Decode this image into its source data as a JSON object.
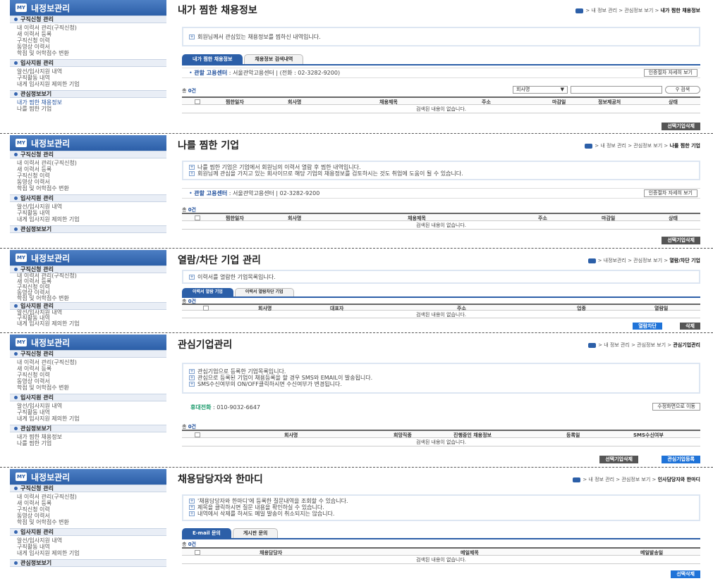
{
  "sidebar": {
    "title": "내정보관리",
    "icon_text": "MY",
    "sec_job": "구직신청 관리",
    "job_items": [
      "내 이력서 관리(구직신청)",
      "새 이력서 등록",
      "구직신청 이력",
      "동영상 이력서",
      "학점 및 어학점수 변환"
    ],
    "sec_apply": "입사지원 관리",
    "apply_items": [
      "알선/입사지원 내역",
      "구직활동 내역",
      "내게 입사지원 제의한 기업"
    ],
    "sec_interest": "관심정보보기",
    "interest_items": [
      "내가 찜한 채용정보",
      "나를 찜한 기업"
    ]
  },
  "common": {
    "center_label": "관할 고용센터",
    "center_value": "서울관악고용센터 | (전화 : 02-3282-9200)",
    "center_value2": "서울관악고용센터 | 02-3282-9200",
    "guide_btn": "인증절차 자세히 보기",
    "empty": "검색된 내용이 없습니다.",
    "count_label": "총",
    "count_value": "0건",
    "crumb_prefix": "> 내 정보 관리 > 관심정보 보기 >"
  },
  "p1": {
    "title": "내가 찜한 채용정보",
    "crumb_end": "내가 찜한 채용정보",
    "info": [
      "회원님께서 관심있는 채용정보를 찜하신 내역입니다."
    ],
    "tabs": [
      "내가 찜한 채용정보",
      "채용정보 검색내역"
    ],
    "search_select": "회사명",
    "search_btn": "검색",
    "cols": [
      "찜한일자",
      "회사명",
      "채용제목",
      "주소",
      "마감일",
      "정보제공처",
      "상태"
    ],
    "btn": "선택기업삭제"
  },
  "p2": {
    "title": "나를 찜한 기업",
    "crumb_end": "나를 찜한 기업",
    "info": [
      "나를 찜한 기업은 기업에서 회원님의 이력서 열람 후 찜한 내역입니다.",
      "회원님께 관심을 가지고 있는 회사이므로 해당 기업의 채용정보를 검토하시는 것도 취업에 도움이 될 수 있습니다."
    ],
    "cols": [
      "찜한일자",
      "회사명",
      "채용제목",
      "주소",
      "마감일",
      "상태"
    ],
    "btn": "선택기업삭제"
  },
  "p3": {
    "title": "열람/차단 기업 관리",
    "crumb_end": "열람/차단 기업",
    "crumb_prefix": "> 내정보관리 > 관심정보 보기 >",
    "info": [
      "이력서를 열람한 기업목록입니다."
    ],
    "tabs": [
      "이력서 열람 기업",
      "이력서 열람차단 기업"
    ],
    "cols": [
      "회사명",
      "대표자",
      "주소",
      "업종",
      "열람일"
    ],
    "btn_block": "열람차단",
    "btn_del": "삭제"
  },
  "p4": {
    "title": "관심기업관리",
    "crumb_end": "관심기업관리",
    "info": [
      "관심기업으로 등록한 기업목록입니다.",
      "관심으로 등록된 기업이 채용등록을 할 경우 SMS와 EMAIL이 발송됩니다.",
      "SMS수신여부의 ON/OFF클릭하시면 수신여부가 변경됩니다."
    ],
    "phone_label": "휴대전화",
    "phone_value": "010-9032-6647",
    "edit_btn": "수정화면으로 이동",
    "cols": [
      "회사명",
      "희망직종",
      "진행중인 채용정보",
      "등록일",
      "SMS수신여부"
    ],
    "btn_del": "선택기업삭제",
    "btn_reg": "관심기업등록"
  },
  "p5": {
    "title": "채용담당자와 한마디",
    "crumb_end": "인사담당자와 한마디",
    "info": [
      "'채용담당자와 한마디'에 등록한 질문내역을 조회할 수 있습니다.",
      "제목을 클릭하시면 질문 내용을 확인하실 수 있습니다.",
      "내역에서 삭제를 하셔도 메일 발송이 취소되지는 않습니다."
    ],
    "tabs": [
      "E-mail 문의",
      "게시판 문의"
    ],
    "cols": [
      "채용담당자",
      "메일제목",
      "메일발송일"
    ],
    "btn": "선택삭제"
  }
}
